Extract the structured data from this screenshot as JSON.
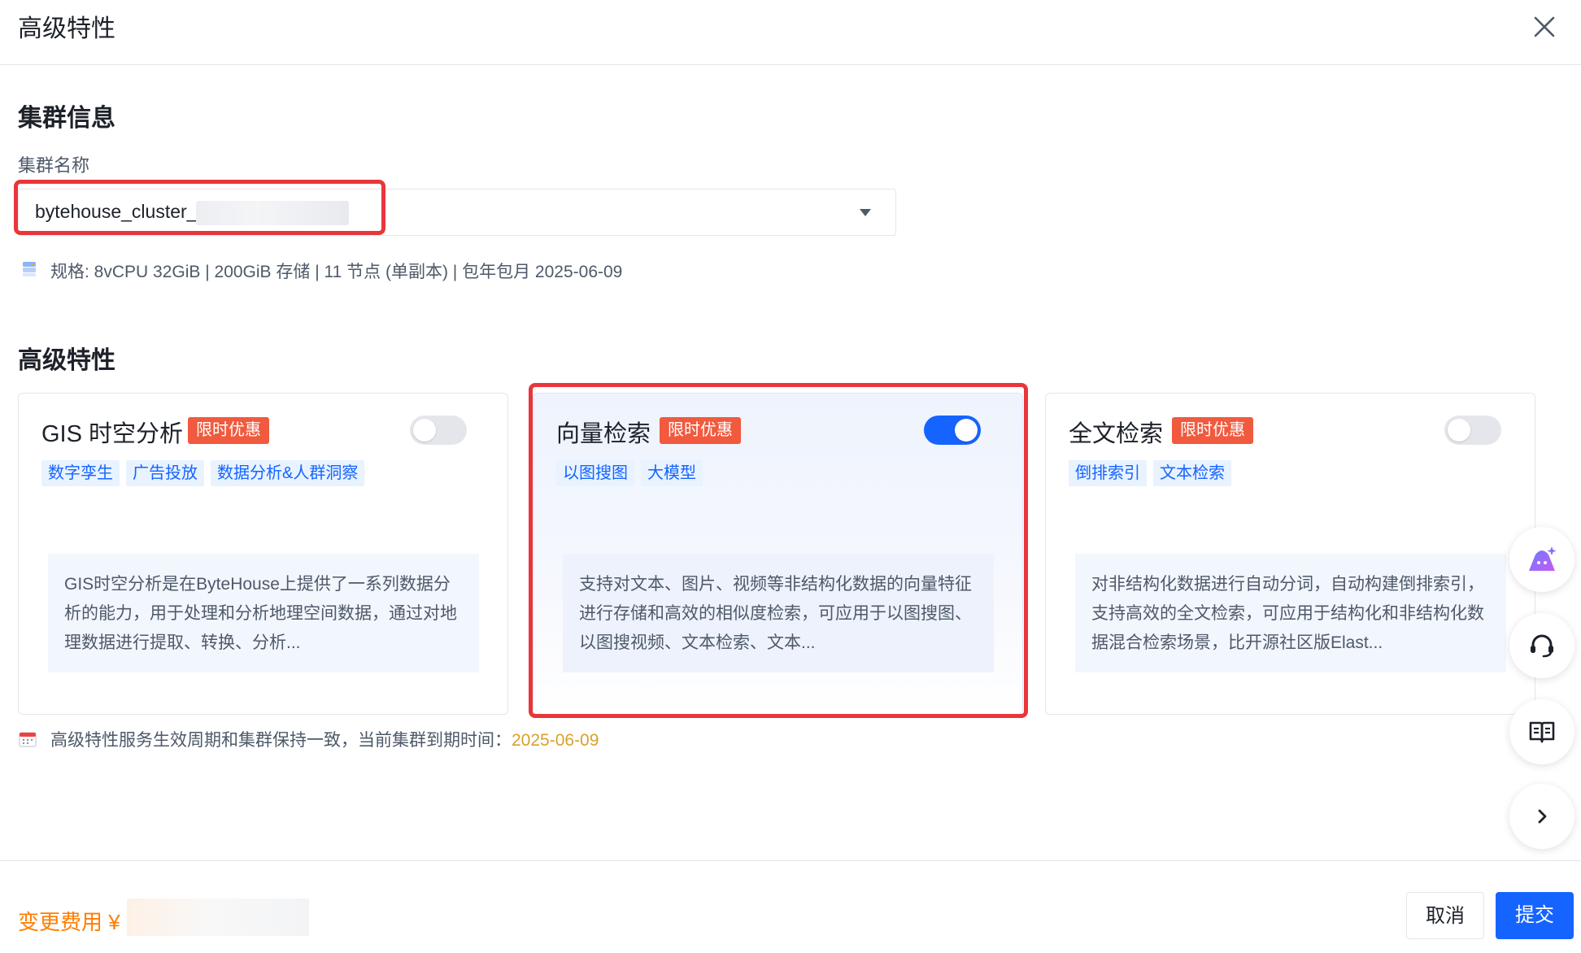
{
  "header": {
    "title": "高级特性"
  },
  "cluster_section": {
    "title": "集群信息",
    "field_label": "集群名称",
    "cluster_name": "bytehouse_cluster_",
    "spec": "规格: 8vCPU 32GiB | 200GiB 存储 | 11 节点 (单副本) | 包年包月 2025-06-09"
  },
  "features_section": {
    "title": "高级特性",
    "cards": [
      {
        "title": "GIS 时空分析",
        "promo": "限时优惠",
        "enabled": false,
        "tags": [
          "数字孪生",
          "广告投放",
          "数据分析&人群洞察"
        ],
        "description": "GIS时空分析是在ByteHouse上提供了一系列数据分析的能力，用于处理和分析地理空间数据，通过对地理数据进行提取、转换、分析..."
      },
      {
        "title": "向量检索",
        "promo": "限时优惠",
        "enabled": true,
        "tags": [
          "以图搜图",
          "大模型"
        ],
        "description": "支持对文本、图片、视频等非结构化数据的向量特征进行存储和高效的相似度检索，可应用于以图搜图、以图搜视频、文本检索、文本..."
      },
      {
        "title": "全文检索",
        "promo": "限时优惠",
        "enabled": false,
        "tags": [
          "倒排索引",
          "文本检索"
        ],
        "description": "对非结构化数据进行自动分词，自动构建倒排索引，支持高效的全文检索，可应用于结构化和非结构化数据混合检索场景，比开源社区版Elast..."
      }
    ],
    "note": "高级特性服务生效周期和集群保持一致，当前集群到期时间：",
    "note_date": "2025-06-09"
  },
  "side_tools": [
    "ai-assistant-icon",
    "customer-service-icon",
    "docs-icon",
    "chevron-right-icon"
  ],
  "footer": {
    "fee_label": "变更费用 ¥",
    "cancel_label": "取消",
    "submit_label": "提交"
  },
  "colors": {
    "primary": "#1664ff",
    "promo": "#f15a3e",
    "highlight": "#e9363b",
    "fee": "#ff7d00",
    "date": "#d8a12b"
  }
}
